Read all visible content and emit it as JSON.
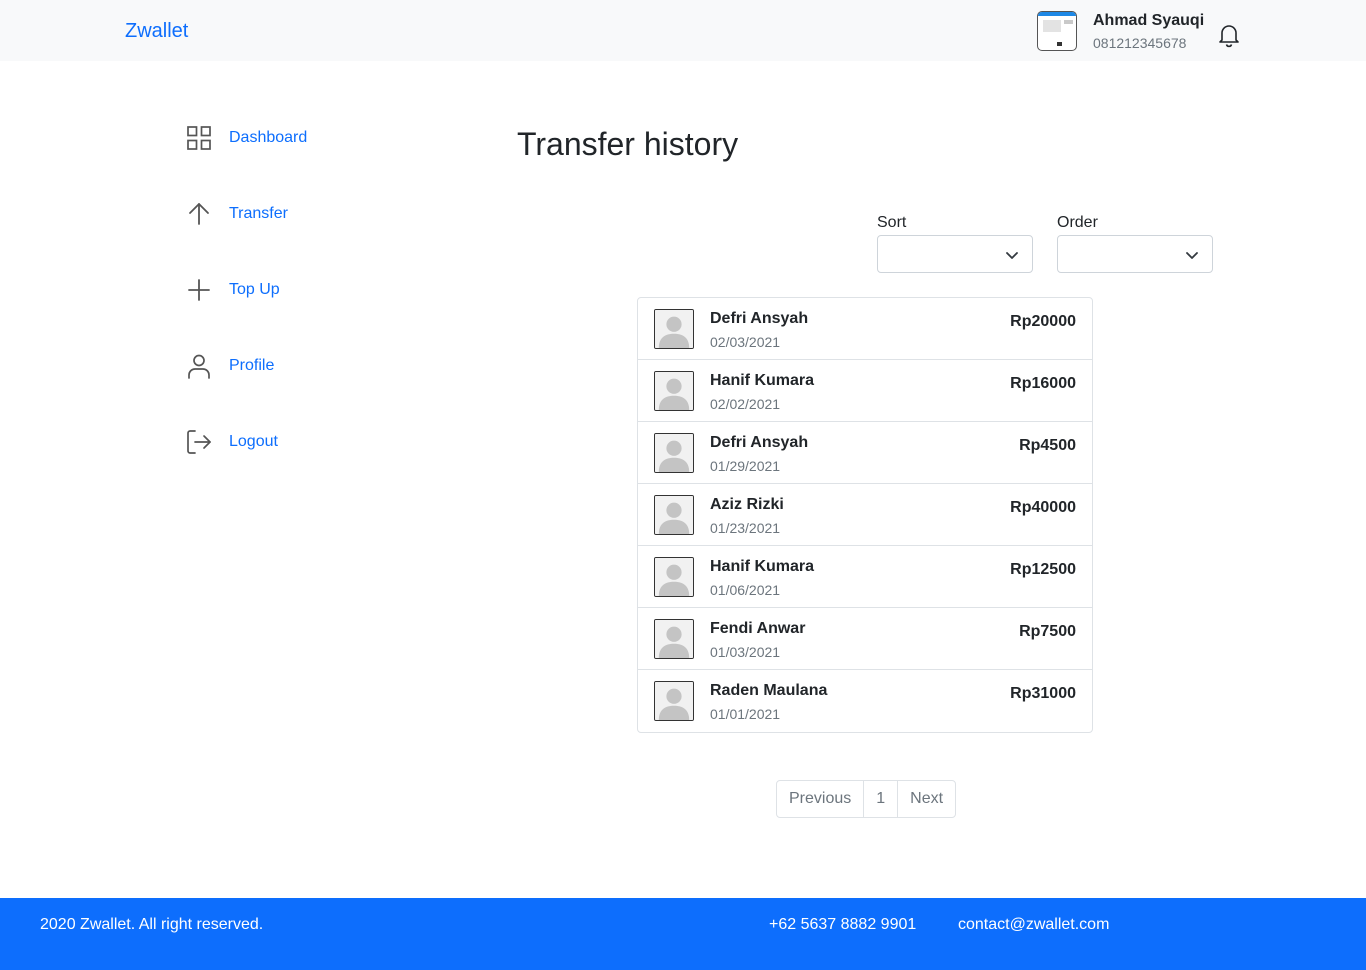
{
  "navbar": {
    "brand": "Zwallet",
    "user_name": "Ahmad Syauqi",
    "user_phone": "081212345678",
    "bell_icon": "bell-icon"
  },
  "sidebar": {
    "items": [
      {
        "label": "Dashboard",
        "icon": "grid-icon"
      },
      {
        "label": "Transfer",
        "icon": "arrow-up-icon"
      },
      {
        "label": "Top Up",
        "icon": "plus-icon"
      },
      {
        "label": "Profile",
        "icon": "user-icon"
      },
      {
        "label": "Logout",
        "icon": "logout-icon"
      }
    ]
  },
  "main": {
    "title": "Transfer history",
    "filters": {
      "sort_label": "Sort",
      "sort_value": "",
      "order_label": "Order",
      "order_value": ""
    },
    "transactions": [
      {
        "name": "Defri Ansyah",
        "date": "02/03/2021",
        "amount": "Rp20000"
      },
      {
        "name": "Hanif Kumara",
        "date": "02/02/2021",
        "amount": "Rp16000"
      },
      {
        "name": "Defri Ansyah",
        "date": "01/29/2021",
        "amount": "Rp4500"
      },
      {
        "name": "Aziz Rizki",
        "date": "01/23/2021",
        "amount": "Rp40000"
      },
      {
        "name": "Hanif Kumara",
        "date": "01/06/2021",
        "amount": "Rp12500"
      },
      {
        "name": "Fendi Anwar",
        "date": "01/03/2021",
        "amount": "Rp7500"
      },
      {
        "name": "Raden Maulana",
        "date": "01/01/2021",
        "amount": "Rp31000"
      }
    ],
    "pagination": {
      "previous": "Previous",
      "page": "1",
      "next": "Next"
    }
  },
  "footer": {
    "copyright": "2020 Zwallet. All right reserved.",
    "phone": "+62 5637 8882 9901",
    "email": "contact@zwallet.com"
  },
  "colors": {
    "primary": "#0d6efd",
    "navbar_bg": "#f8f9fa",
    "muted_text": "#6c757d",
    "border": "#dee2e6"
  }
}
